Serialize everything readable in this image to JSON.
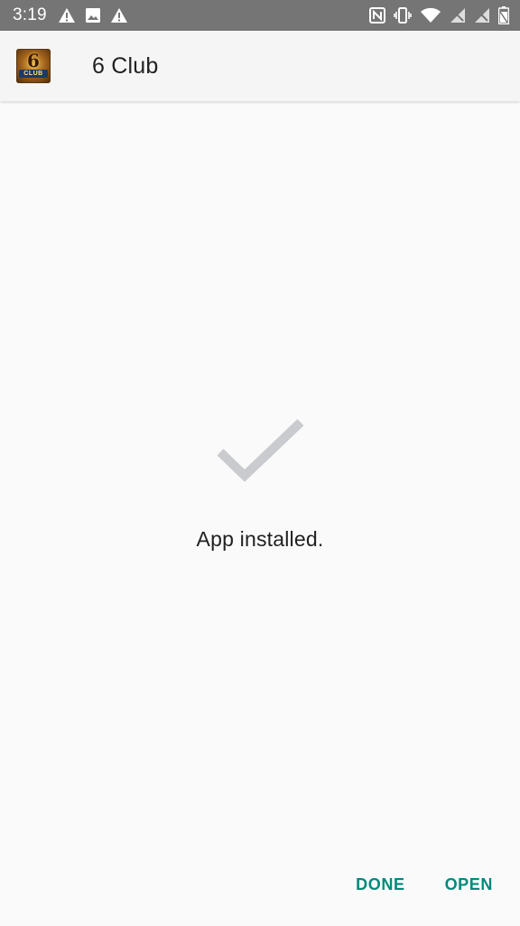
{
  "status_bar": {
    "time": "3:19",
    "left_icons": [
      "warning-icon",
      "image-icon",
      "warning-icon"
    ],
    "right_icons": [
      "nfc-icon",
      "vibrate-icon",
      "wifi-icon",
      "signal-icon",
      "signal-icon",
      "battery-icon"
    ]
  },
  "app_bar": {
    "app_name": "6 Club",
    "icon": {
      "number": "6",
      "label": "CLUB"
    }
  },
  "content": {
    "message": "App installed.",
    "icon": "checkmark-icon"
  },
  "actions": {
    "done_label": "DONE",
    "open_label": "OPEN"
  },
  "colors": {
    "status_bar": "#757575",
    "app_bar": "#f5f5f5",
    "background": "#fafafa",
    "accent": "#00897b",
    "checkmark": "#c9cbce",
    "text": "#212121"
  }
}
